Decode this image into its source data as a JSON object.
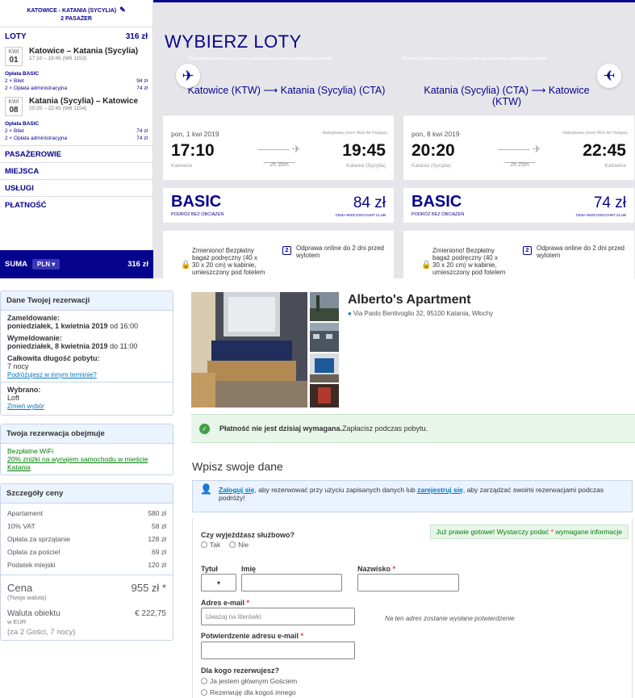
{
  "wizz": {
    "route_title": "KATOWICE - KATANIA (SYCYLIA)",
    "passengers": "2 PASAŻER",
    "loty_label": "LOTY",
    "loty_total": "316 zł",
    "flights": [
      {
        "month": "KWI",
        "day": "01",
        "route": "Katowice – Katania (Sycylia)",
        "time": "17:10 – 19:45 (W6 1153)",
        "fee_head": "Opłata BASIC",
        "fee1_label": "2 × Bilet",
        "fee1_value": "94 zł",
        "fee2_label": "2 × Opłata administracyjna",
        "fee2_value": "74 zł"
      },
      {
        "month": "KWI",
        "day": "08",
        "route": "Katania (Sycylia) – Katowice",
        "time": "20:20 – 22:45 (W6 1154)",
        "fee_head": "Opłata BASIC",
        "fee1_label": "2 × Bilet",
        "fee1_value": "74 zł",
        "fee2_label": "2 × Opłata administracyjna",
        "fee2_value": "74 zł"
      }
    ],
    "sections": [
      "PASAŻEROWIE",
      "MIEJSCA",
      "USŁUGI",
      "PŁATNOŚĆ"
    ],
    "suma_label": "SUMA",
    "currency": "PLN",
    "suma_total": "316 zł",
    "main_title": "WYBIERZ LOTY",
    "price_note": "Wszystkie podane ceny to ceny za jednego pasażera zawierające podatki.",
    "cards": [
      {
        "route": "Katowice (KTW) ⟶ Katania (Sycylia) (CTA)",
        "date": "pon, 1 kwi 2019",
        "operator": "obsługiwany przez Wizz Air Hungary",
        "dep": "17:10",
        "arr": "19:45",
        "duration": "2h 35m",
        "dep_city": "Katowice",
        "arr_city": "Katania (Sycylia)",
        "fare": "BASIC",
        "fare_sub": "PODRÓŻ BEZ OBCIĄŻEŃ",
        "price": "84 zł",
        "club": "CENA WIZZ DISCOUNT CLUB",
        "bag": "Zmieniono! Bezpłatny bagaż podręczny (40 x 30 x 20 cm) w kabinie, umieszczony pod fotelem",
        "checkin": "Odprawa online do 2 dni przed wylotem"
      },
      {
        "route": "Katania (Sycylia) (CTA) ⟶ Katowice (KTW)",
        "date": "pon, 8 kwi 2019",
        "operator": "obsługiwany przez Wizz Air Hungary",
        "dep": "20:20",
        "arr": "22:45",
        "duration": "2h 25m",
        "dep_city": "Katania (Sycylia)",
        "arr_city": "Katowice",
        "fare": "BASIC",
        "fare_sub": "PODRÓŻ BEZ OBCIĄŻEŃ",
        "price": "74 zł",
        "club": "CENA WIZZ DISCOUNT CLUB",
        "bag": "Zmieniono! Bezpłatny bagaż podręczny (40 x 30 x 20 cm) w kabinie, umieszczony pod fotelem",
        "checkin": "Odprawa online do 2 dni przed wylotem"
      }
    ],
    "calendar_num": "2"
  },
  "booking": {
    "details": {
      "title": "Dane Twojej rezerwacji",
      "checkin_label": "Zameldowanie:",
      "checkin_date": "poniedziałek, 1 kwietnia 2019",
      "checkin_time": " od 16:00",
      "checkout_label": "Wymeldowanie:",
      "checkout_date": "poniedziałek, 8 kwietnia 2019",
      "checkout_time": " do 11:00",
      "length_label": "Całkowita długość pobytu:",
      "length_value": "7 nocy",
      "change_dates_link": "Podróżujesz w innym terminie?",
      "chosen_label": "Wybrano:",
      "chosen_value": "Loft",
      "change_choice_link": "Zmień wybór"
    },
    "includes": {
      "title": "Twoja rezerwacja obejmuje",
      "wifi": "Bezpłatne WiFi",
      "car": "20% zniżki na wynajem samochodu w mieście Katania"
    },
    "price": {
      "title": "Szczegóły ceny",
      "rows": [
        {
          "label": "Apartament",
          "value": "580 zł"
        },
        {
          "label": "10% VAT",
          "value": "58 zł"
        },
        {
          "label": "Opłata za sprzątanie",
          "value": "128 zł"
        },
        {
          "label": "Opłata za pościel",
          "value": "69 zł"
        },
        {
          "label": "Podatek miejski",
          "value": "120 zł"
        }
      ],
      "total_label": "Cena",
      "total_sub": "(Twoja waluta)",
      "total_value": "955 zł *",
      "prop_label": "Waluta obiektu",
      "prop_sub": "w EUR",
      "prop_value": "€ 222,75",
      "guests": "(za 2 Gości, 7 nocy)"
    },
    "hotel": {
      "name": "Alberto's Apartment",
      "address": "Via Paolo Bentivoglio 32, 95100 Katania, Włochy"
    },
    "pay_bold": "Płatność nie jest dzisiaj wymagana.",
    "pay_rest": " Zapłacisz podczas pobytu.",
    "form_title": "Wpisz swoje dane",
    "login_link": "Zaloguj się",
    "login_mid": ", aby rezerwować przy użyciu zapisanych danych lub ",
    "register_link": "zarejestruj się",
    "login_end": ", aby zarządzać swoimi rezerwacjami podczas podróży!",
    "almost_pre": "Już prawie gotowe! Wystarczy podać ",
    "almost_star": "*",
    "almost_post": " wymagane informacje",
    "business_q": "Czy wyjeżdżasz służbowo?",
    "yes": "Tak",
    "no": "Nie",
    "title_label": "Tytuł",
    "first_label": "Imię",
    "last_label": "Nazwisko",
    "req_star": "*",
    "email_label": "Adres e-mail",
    "email_placeholder": "Uważaj na literówki",
    "email_hint": "Na ten adres zostanie wysłane potwierdzenie",
    "email_confirm_label": "Potwierdzenie adresu e-mail",
    "for_whom": "Dla kogo rezerwujesz?",
    "main_guest": "Ja jestem głównym Gościem",
    "other_guest": "Rezerwuję dla kogoś innego"
  }
}
